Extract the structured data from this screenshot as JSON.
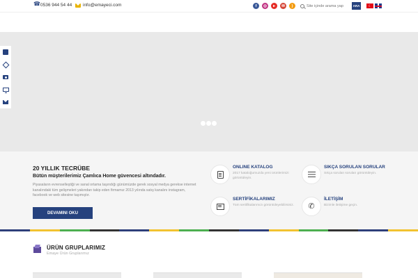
{
  "topbar": {
    "phone": "0536 944 54 44",
    "email": "info@emayeci.com",
    "search_placeholder": "Site içinde arama yap",
    "search_button": "ARA",
    "socials": [
      {
        "icon": "facebook-icon",
        "color": "#3b5998"
      },
      {
        "icon": "instagram-icon",
        "color": "#c13584"
      },
      {
        "icon": "youtube-icon",
        "color": "#e52d27"
      },
      {
        "icon": "email-icon",
        "color": "#d44638"
      },
      {
        "icon": "rss-icon",
        "color": "#f39c12"
      }
    ],
    "flags": [
      "turkish-flag-icon",
      "english-flag-icon"
    ]
  },
  "about": {
    "title": "20 YILLIK TECRÜBE",
    "subtitle": "Bütün müşterilerimiz Çamlıca Home güvencesi altındadır.",
    "text": "Piyasaların evrenselleştiği ve sanal ortama taşındığı günümüzde gerek sosyal medya gerekse internet kanalındaki tüm gelişmeleri yakından takip eden firmamız 2013 yılında satış kanalını instagram, facebook ve web sitesine taşımıştır.",
    "button": "DEVAMINI OKU"
  },
  "features": [
    {
      "title": "ONLINE KATALOG",
      "desc": "2017 kataloğumuzda yeni ürünlerimizi görüntüleyin.",
      "icon": "catalog-icon"
    },
    {
      "title": "SIKÇA SORULAN SORULAR",
      "desc": "Sıkça sorulan soruları görüntüleyin.",
      "icon": "faq-list-icon"
    },
    {
      "title": "SERTİFİKALARIMIZ",
      "desc": "Tüm sertifikalarımızı görüntüleyebilirsiniz.",
      "icon": "certificate-icon"
    },
    {
      "title": "İLETİŞİM",
      "desc": "Bizimle iletişime geçin.",
      "icon": "phone-icon"
    }
  ],
  "groups": {
    "title": "ÜRÜN GRUPLARIMIZ",
    "subtitle": "Emaye Ürün Gruplarımız"
  },
  "colors": {
    "primary": "#26427e",
    "stripe": [
      "#2e3f7a",
      "#f2c230",
      "#4caf50",
      "#333333",
      "#2e3f7a",
      "#f2c230",
      "#4caf50",
      "#333333",
      "#2e3f7a",
      "#f2c230",
      "#4caf50",
      "#333333",
      "#2e3f7a",
      "#f2c230"
    ]
  }
}
